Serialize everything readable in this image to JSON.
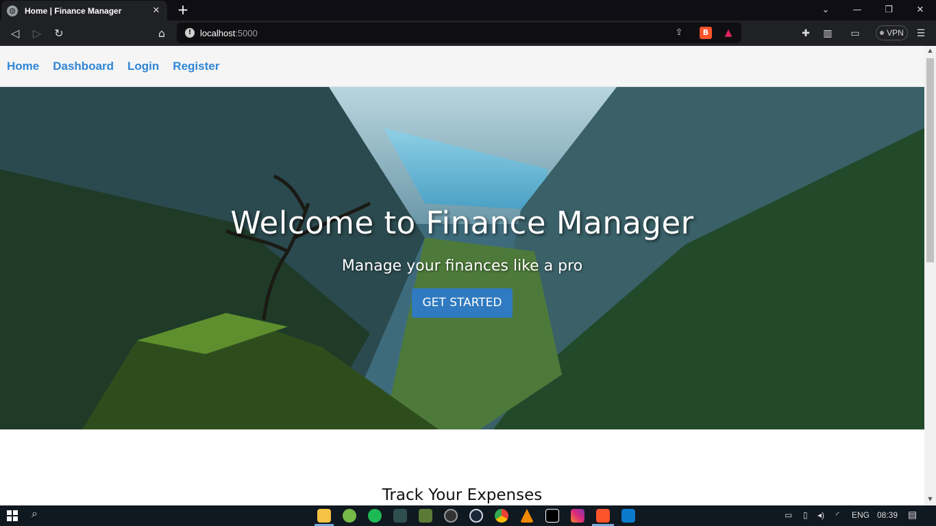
{
  "browser": {
    "tab_title": "Home | Finance Manager",
    "close_glyph": "✕",
    "new_tab_glyph": "+",
    "url_host": "localhost",
    "url_port": ":5000",
    "vpn_label": "VPN",
    "icons": [
      "globe-icon",
      "back-icon",
      "forward-icon",
      "reload-icon",
      "bookmark-icon",
      "info-icon",
      "share-icon",
      "brave-shields-icon",
      "brave-rewards-icon",
      "extensions-icon",
      "sidebar-icon",
      "wallet-icon",
      "menu-icon"
    ]
  },
  "navbar": {
    "links": [
      "Home",
      "Dashboard",
      "Login",
      "Register"
    ],
    "link_color": "#2f86d6"
  },
  "hero": {
    "title": "Welcome to Finance Manager",
    "subtitle": "Manage your finances like a pro",
    "cta_label": "GET STARTED",
    "cta_color": "#2f7ac0"
  },
  "section": {
    "title": "Track Your Expenses"
  },
  "taskbar": {
    "language": "ENG",
    "time": "08:39",
    "apps": [
      "file-explorer-icon",
      "utorrent-icon",
      "spotify-icon",
      "git-icon",
      "minecraft-icon",
      "obs-icon",
      "steam-icon",
      "chrome-icon",
      "vlc-icon",
      "intellij-icon",
      "instagram-icon",
      "brave-icon",
      "vscode-icon"
    ]
  }
}
